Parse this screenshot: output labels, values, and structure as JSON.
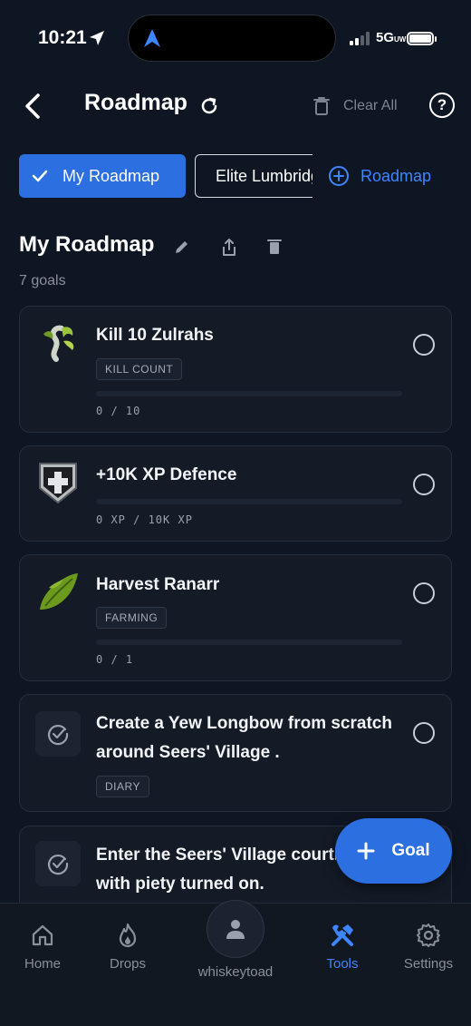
{
  "status": {
    "time": "10:21",
    "network": "5G",
    "network_sub": "UW"
  },
  "header": {
    "title": "Roadmap",
    "clear_all": "Clear All",
    "help": "?"
  },
  "tabs": [
    {
      "label": "My Roadmap",
      "active": true
    },
    {
      "label": "Elite Lumbridge"
    },
    {
      "label": "Roadmap"
    }
  ],
  "section": {
    "title": "My Roadmap",
    "count": "7 goals"
  },
  "goals": [
    {
      "title": "Kill 10 Zulrahs",
      "badge": "KILL COUNT",
      "progress_text": "0 / 10",
      "progress": 0,
      "icon": "zulrah-icon"
    },
    {
      "title": "+10K XP Defence",
      "progress_text": "0 XP / 10K XP",
      "progress": 0,
      "icon": "defence-shield-icon"
    },
    {
      "title": "Harvest Ranarr",
      "badge": "FARMING",
      "progress_text": "0 / 1",
      "progress": 0,
      "icon": "ranarr-herb-icon"
    },
    {
      "title_line1": "Create a Yew Longbow from scratch",
      "title_line2": "around Seers' Village .",
      "badge": "DIARY",
      "icon": "checkmark-badge-icon"
    },
    {
      "title_line1": "Enter the Seers' Village courthouse",
      "title_line2": "with piety turned on.",
      "icon": "checkmark-badge-icon"
    }
  ],
  "fab": {
    "label": "Goal"
  },
  "tabbar": {
    "home": "Home",
    "drops": "Drops",
    "user": "whiskeytoad",
    "tools": "Tools",
    "settings": "Settings"
  },
  "colors": {
    "accent": "#3d86ff",
    "button": "#2b6fe0",
    "background": "#0f1623",
    "card": "#141b27"
  }
}
